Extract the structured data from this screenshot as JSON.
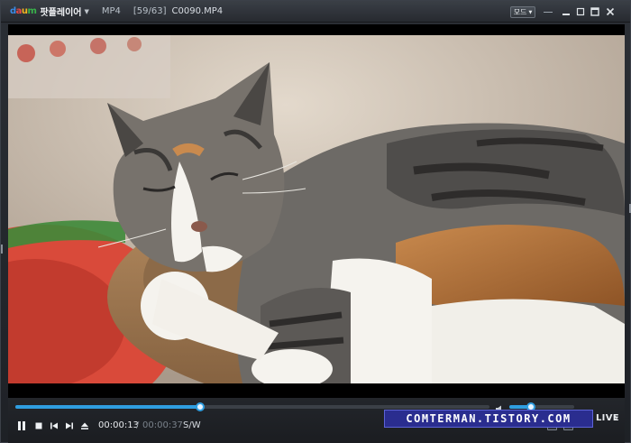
{
  "titlebar": {
    "logo_letters": [
      "d",
      "a",
      "u",
      "m"
    ],
    "app_name": "팟플레이어",
    "format": "MP4",
    "playlist_position": "[59/63]",
    "file_name": "C0090.MP4",
    "mode_label": "모드"
  },
  "video": {
    "description_icon": "video-frame"
  },
  "controls": {
    "seek_progress": 0.39,
    "volume_level": 0.33,
    "current_time": "00:00:13",
    "time_separator": "/",
    "total_time": "00:00:37",
    "sw_label": "S/W",
    "live_label": "LIVE"
  },
  "watermark": {
    "text": "COMTERMAN.TISTORY.COM"
  },
  "colors": {
    "accent": "#2f9ee0",
    "watermark_bg": "#2a2d8f"
  }
}
